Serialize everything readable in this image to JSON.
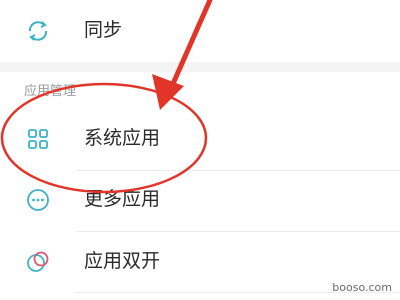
{
  "top_item": {
    "label": "同步",
    "icon": "sync-icon"
  },
  "section": {
    "title": "应用管理"
  },
  "items": [
    {
      "label": "系统应用",
      "icon": "grid-apps-icon"
    },
    {
      "label": "更多应用",
      "icon": "more-dots-icon"
    },
    {
      "label": "应用双开",
      "icon": "dual-apps-icon"
    }
  ],
  "colors": {
    "accent_icon": "#3db3c8",
    "annotation": "#e2352a"
  },
  "watermark": "booso.com"
}
